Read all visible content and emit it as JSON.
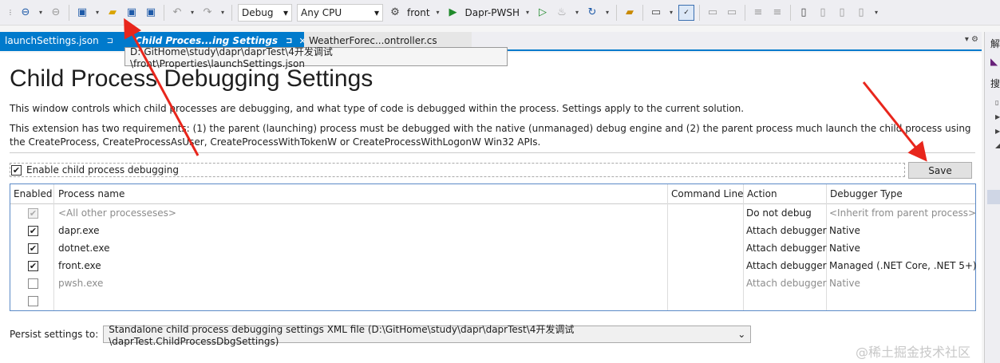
{
  "toolbar": {
    "config": "Debug",
    "platform": "Any CPU",
    "startup_project": "front",
    "profile": "Dapr-PWSH"
  },
  "tabs": [
    {
      "label": "launchSettings.json",
      "pin": "⊐",
      "close": ""
    },
    {
      "label": "Child Proces...ing Settings",
      "pin": "⊐",
      "close": "✕"
    },
    {
      "label": "WeatherForec...ontroller.cs",
      "pin": "",
      "close": ""
    }
  ],
  "tooltip": "D:\\GitHome\\study\\dapr\\daprTest\\4开发调试\\front\\Properties\\launchSettings.json",
  "page": {
    "title": "Child Process Debugging Settings",
    "desc1": "This window controls which child processes are debugging, and what type of code is debugged within the process. Settings apply to the current solution.",
    "desc2": "This extension has two requirements: (1) the parent (launching) process must be debugged with the native (unmanaged) debug engine and (2) the parent process much launch the child process using the CreateProcess, CreateProcessAsUser, CreateProcessWithTokenW or CreateProcessWithLogonW Win32 APIs.",
    "enable_label": "Enable child process debugging",
    "enable_checked": true,
    "save_label": "Save"
  },
  "grid": {
    "headers": [
      "Enabled",
      "Process name",
      "Command Line",
      "Action",
      "Debugger Type"
    ],
    "rows": [
      {
        "enabled": true,
        "name": "<All other processeses>",
        "cmd": "",
        "action": "Do not debug",
        "debugger": "<Inherit from parent process>"
      },
      {
        "enabled": true,
        "name": "dapr.exe",
        "cmd": "",
        "action": "Attach debugger",
        "debugger": "Native"
      },
      {
        "enabled": true,
        "name": "dotnet.exe",
        "cmd": "",
        "action": "Attach debugger",
        "debugger": "Native"
      },
      {
        "enabled": true,
        "name": "front.exe",
        "cmd": "",
        "action": "Attach debugger",
        "debugger": "Managed (.NET Core, .NET 5+)"
      },
      {
        "enabled": false,
        "name": "pwsh.exe",
        "cmd": "",
        "action": "Attach debugger",
        "debugger": "Native"
      },
      {
        "enabled": false,
        "name": "",
        "cmd": "",
        "action": "",
        "debugger": ""
      }
    ]
  },
  "persist": {
    "label": "Persist settings to:",
    "value": "Standalone child process debugging settings XML file (D:\\GitHome\\study\\dapr\\daprTest\\4开发调试\\daprTest.ChildProcessDbgSettings)"
  },
  "right_panel": {
    "top_char": "解",
    "search_char": "搜"
  },
  "watermark": "@稀土掘金技术社区",
  "colors": {
    "accent": "#007acc",
    "annotation_arrow": "#e8261c"
  }
}
